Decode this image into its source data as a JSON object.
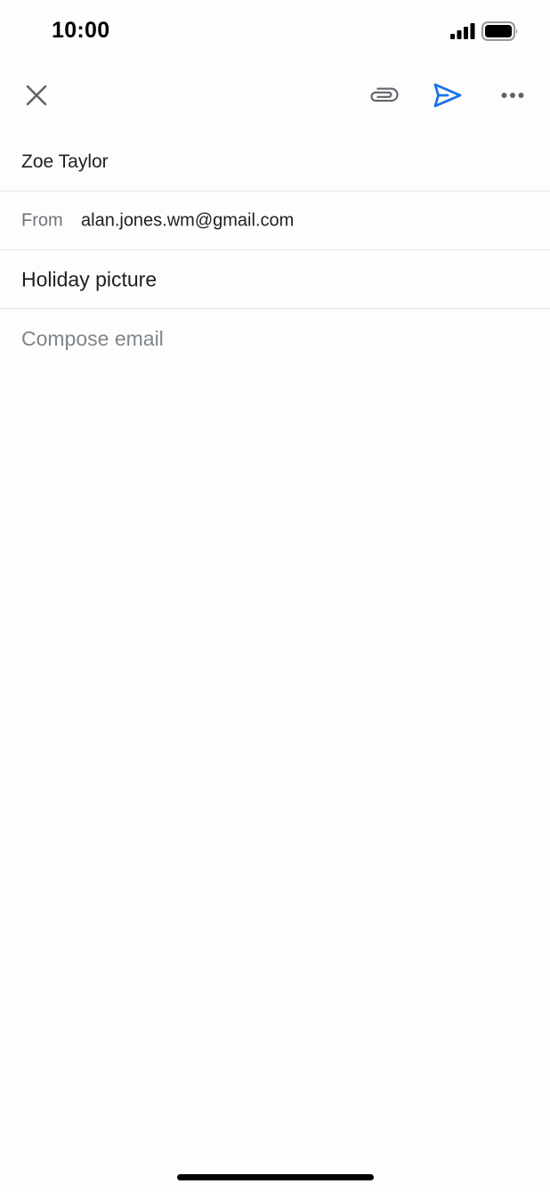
{
  "status_bar": {
    "time": "10:00",
    "signal_icon": "cellular-signal-icon",
    "battery_icon": "battery-icon"
  },
  "toolbar": {
    "close_icon": "close-icon",
    "attach_icon": "paperclip-icon",
    "send_icon": "send-icon",
    "more_icon": "more-horizontal-icon",
    "send_color": "#1a73e8",
    "icon_color": "#5f6368"
  },
  "compose": {
    "to_value": "Zoe Taylor",
    "from_label": "From",
    "from_value": "alan.jones.wm@gmail.com",
    "subject_value": "Holiday picture",
    "body_placeholder": "Compose email"
  }
}
